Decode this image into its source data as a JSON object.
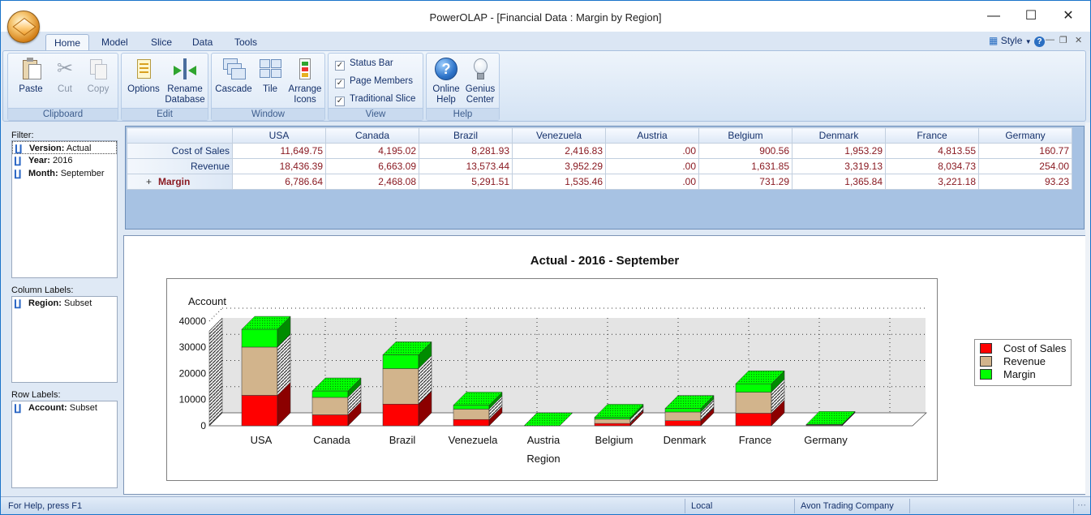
{
  "window": {
    "title": "PowerOLAP - [Financial Data : Margin by Region]",
    "minimize": "—",
    "maximize": "☐",
    "close": "✕"
  },
  "ribbon": {
    "tabs": [
      "Home",
      "Model",
      "Slice",
      "Data",
      "Tools"
    ],
    "active_tab": "Home",
    "style_label": "Style",
    "groups": {
      "clipboard": {
        "label": "Clipboard",
        "paste": "Paste",
        "cut": "Cut",
        "copy": "Copy"
      },
      "edit": {
        "label": "Edit",
        "options": "Options",
        "rename_1": "Rename",
        "rename_2": "Database"
      },
      "window": {
        "label": "Window",
        "cascade": "Cascade",
        "tile": "Tile",
        "arrange_1": "Arrange",
        "arrange_2": "Icons"
      },
      "view": {
        "label": "View",
        "status_bar": "Status Bar",
        "page_members": "Page Members",
        "traditional_slice": "Traditional Slice"
      },
      "help": {
        "label": "Help",
        "online_1": "Online",
        "online_2": "Help",
        "genius_1": "Genius",
        "genius_2": "Center"
      }
    }
  },
  "left_panel": {
    "filter_label": "Filter:",
    "filter_items": [
      {
        "key": "Version:",
        "value": "Actual"
      },
      {
        "key": "Year:",
        "value": "2016"
      },
      {
        "key": "Month:",
        "value": "September"
      }
    ],
    "column_label": "Column Labels:",
    "column_items": [
      {
        "key": "Region:",
        "value": "Subset"
      }
    ],
    "row_label": "Row Labels:",
    "row_items": [
      {
        "key": "Account:",
        "value": "Subset"
      }
    ]
  },
  "grid": {
    "columns": [
      "USA",
      "Canada",
      "Brazil",
      "Venezuela",
      "Austria",
      "Belgium",
      "Denmark",
      "France",
      "Germany"
    ],
    "rows": [
      {
        "label": "Cost of Sales",
        "values": [
          "11,649.75",
          "4,195.02",
          "8,281.93",
          "2,416.83",
          ".00",
          "900.56",
          "1,953.29",
          "4,813.55",
          "160.77"
        ]
      },
      {
        "label": "Revenue",
        "values": [
          "18,436.39",
          "6,663.09",
          "13,573.44",
          "3,952.29",
          ".00",
          "1,631.85",
          "3,319.13",
          "8,034.73",
          "254.00"
        ]
      },
      {
        "label": "Margin",
        "expander": "+",
        "values": [
          "6,786.64",
          "2,468.08",
          "5,291.51",
          "1,535.46",
          ".00",
          "731.29",
          "1,365.84",
          "3,221.18",
          "93.23"
        ]
      }
    ]
  },
  "chart_data": {
    "type": "bar",
    "stacked": true,
    "three_d": true,
    "title": "Actual - 2016 - September",
    "xlabel": "Region",
    "ylabel": "Account",
    "categories": [
      "USA",
      "Canada",
      "Brazil",
      "Venezuela",
      "Austria",
      "Belgium",
      "Denmark",
      "France",
      "Germany"
    ],
    "series": [
      {
        "name": "Cost of Sales",
        "color": "#ff0000",
        "values": [
          11649.75,
          4195.02,
          8281.93,
          2416.83,
          0,
          900.56,
          1953.29,
          4813.55,
          160.77
        ]
      },
      {
        "name": "Revenue",
        "color": "#d2b48c",
        "values": [
          18436.39,
          6663.09,
          13573.44,
          3952.29,
          0,
          1631.85,
          3319.13,
          8034.73,
          254.0
        ]
      },
      {
        "name": "Margin",
        "color": "#00ff00",
        "values": [
          6786.64,
          2468.08,
          5291.51,
          1535.46,
          0,
          731.29,
          1365.84,
          3221.18,
          93.23
        ]
      }
    ],
    "yticks": [
      "0",
      "10000",
      "20000",
      "30000",
      "40000"
    ],
    "ylim": [
      0,
      40000
    ],
    "grid": true,
    "legend_position": "right"
  },
  "status_bar": {
    "help_text": "For Help, press F1",
    "mode": "Local",
    "company": "Avon Trading Company"
  }
}
